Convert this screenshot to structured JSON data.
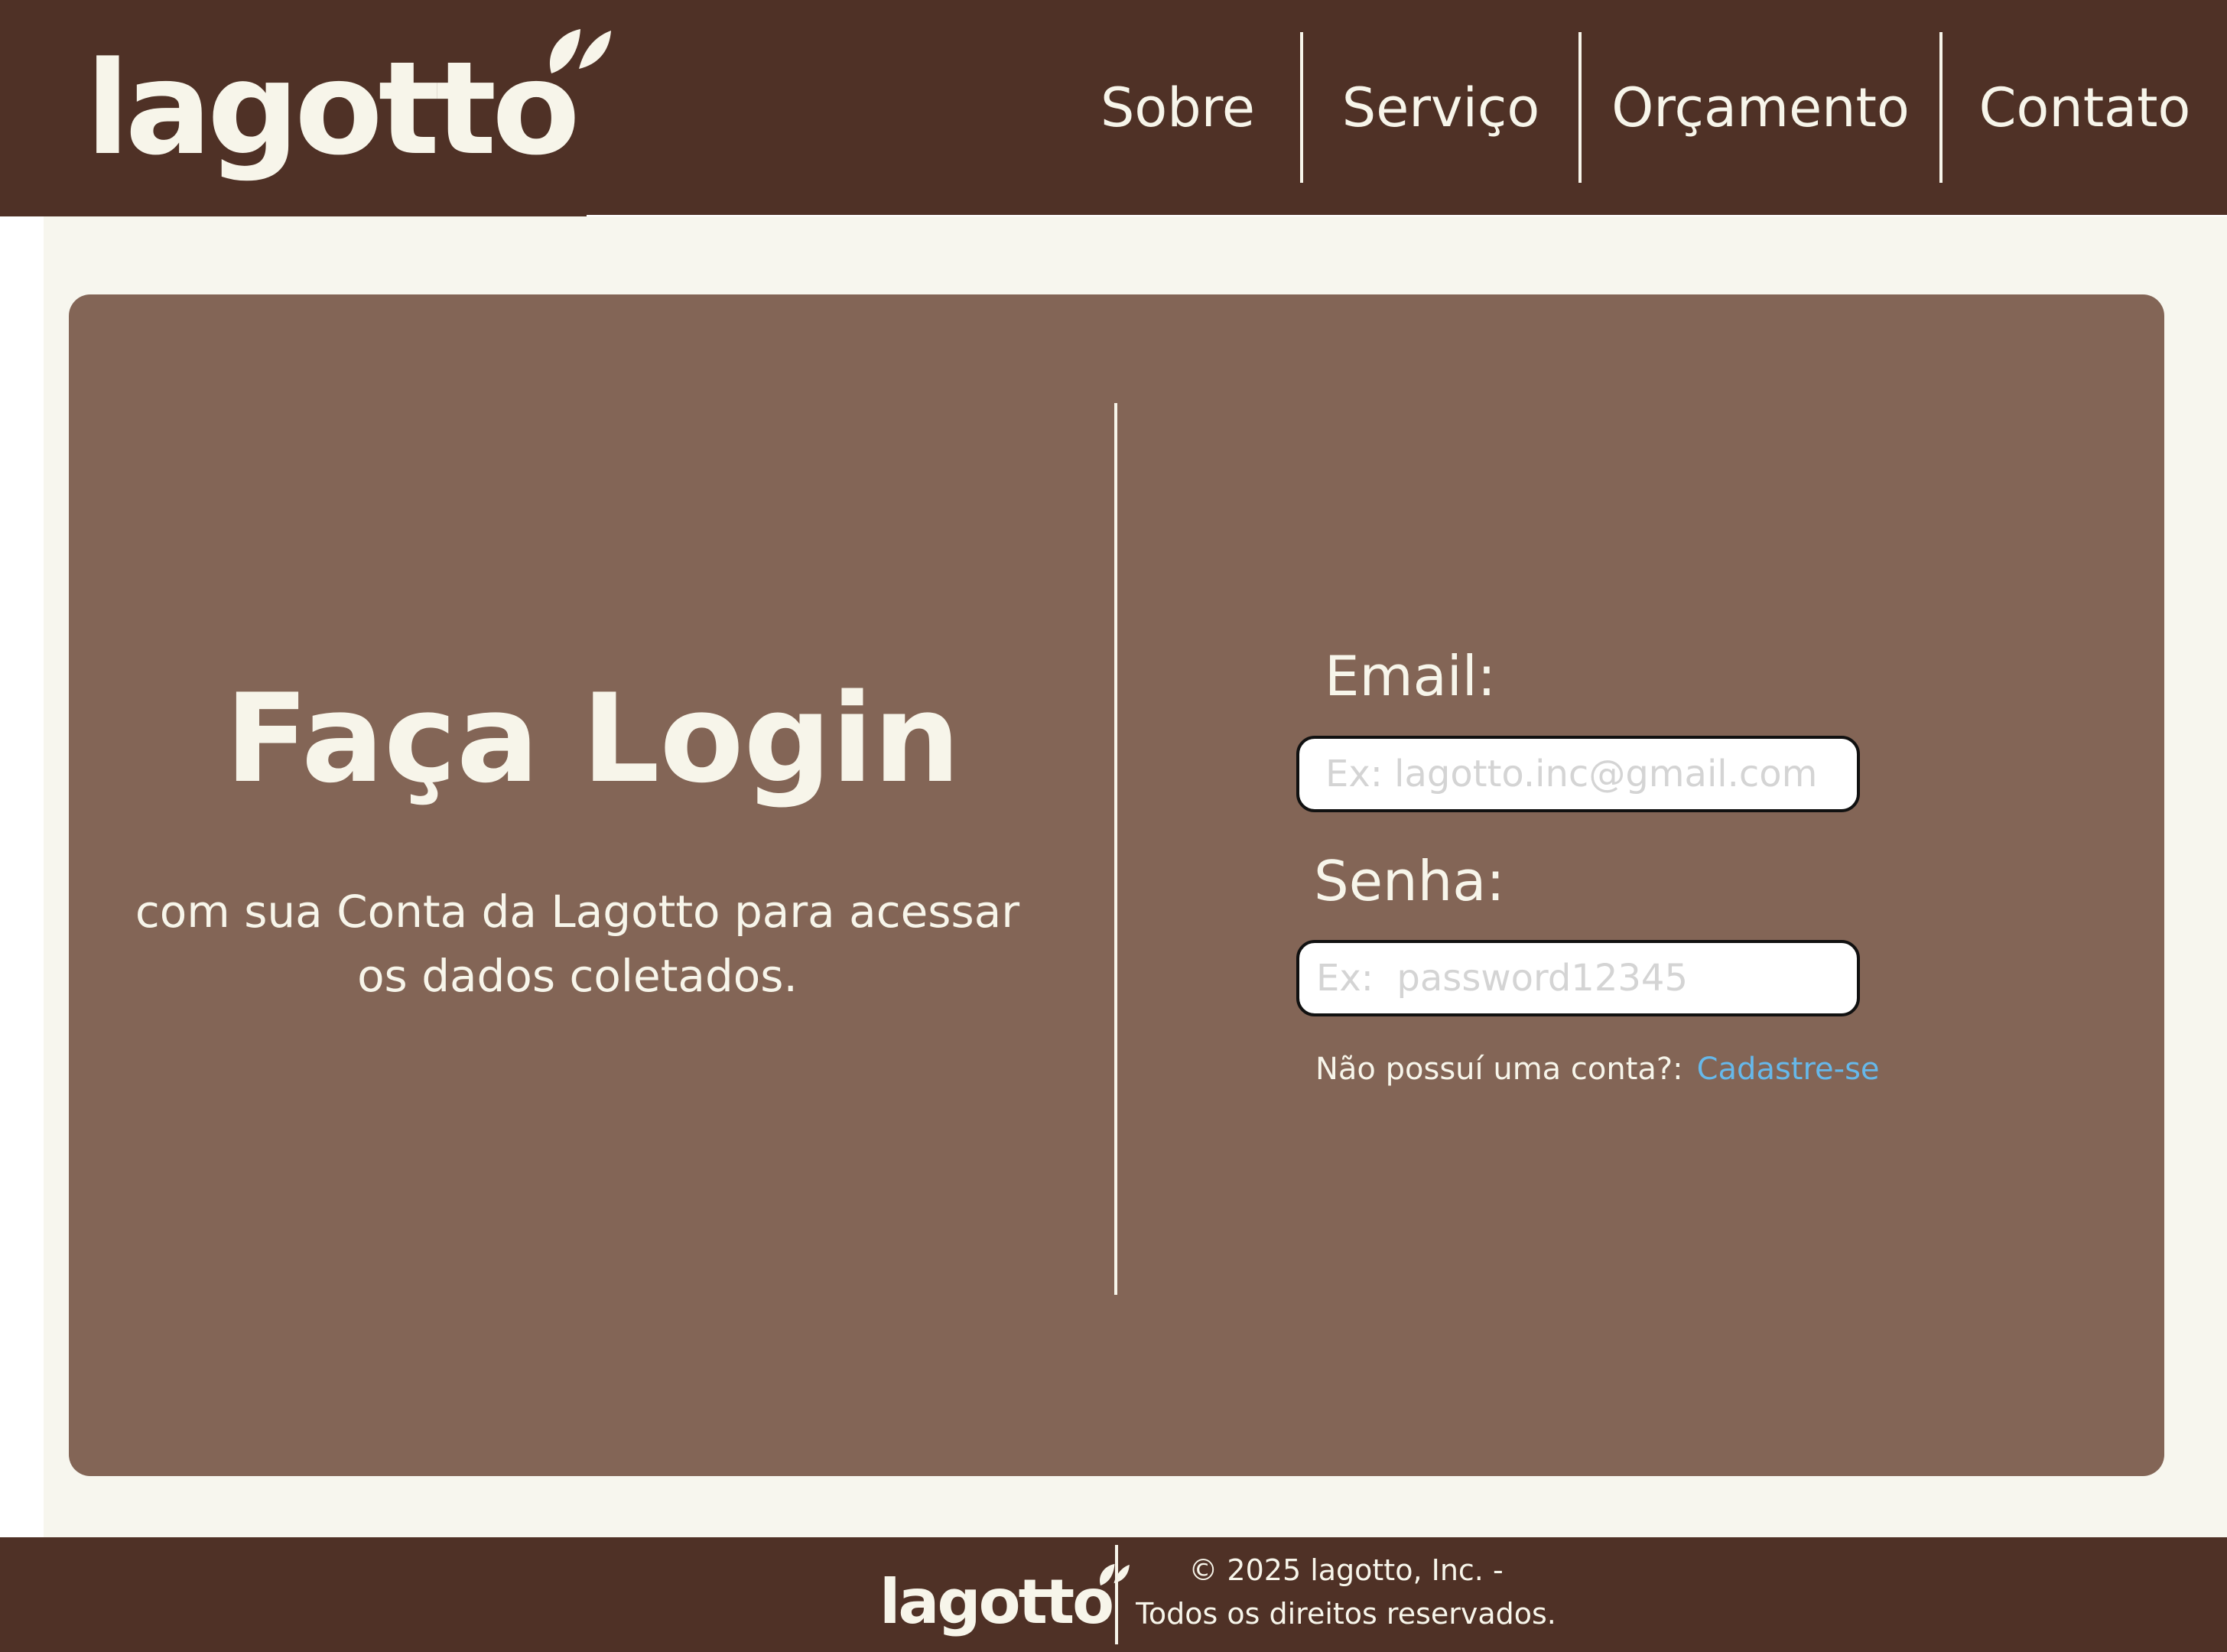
{
  "header": {
    "logo_text": "lagotto",
    "nav": [
      {
        "label": "Sobre"
      },
      {
        "label": "Serviço"
      },
      {
        "label": "Orçamento"
      },
      {
        "label": "Contato"
      }
    ]
  },
  "login": {
    "title": "Faça Login",
    "subtitle": "com sua Conta da Lagotto para acessar os dados coletados."
  },
  "form": {
    "email_label": "Email:",
    "email_placeholder": "Ex: lagotto.inc@gmail.com",
    "password_label": "Senha:",
    "password_placeholder": "Ex:  password12345",
    "no_account_text": "Não possuí uma conta?:",
    "signup_link": "Cadastre-se"
  },
  "footer": {
    "logo_text": "lagotto",
    "copyright_line1": "© 2025 lagotto, Inc. -",
    "copyright_line2": "Todos os direitos reservados."
  },
  "colors": {
    "header_bg": "#4f3126",
    "card_bg": "#836556",
    "page_bg": "#f7f6ee",
    "text_light": "#f7f5ea",
    "link": "#66b8ea"
  }
}
